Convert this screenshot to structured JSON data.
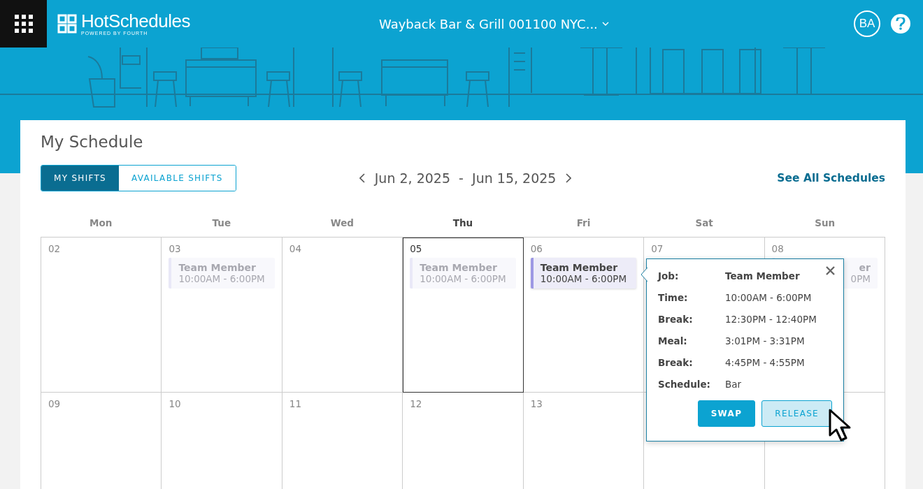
{
  "header": {
    "logo_text": "HotSchedules",
    "logo_tagline": "POWERED BY FOURTH",
    "location": "Wayback Bar & Grill 001100 NYC...",
    "avatar": "BA"
  },
  "page_title": "My Schedule",
  "view_tabs": [
    {
      "label": "MY SHIFTS",
      "selected": true
    },
    {
      "label": "AVAILABLE SHIFTS",
      "selected": false
    }
  ],
  "date_range": {
    "start": "Jun 2, 2025",
    "separator": "-",
    "end": "Jun 15, 2025"
  },
  "see_all_link": "See All Schedules",
  "weekdays": [
    {
      "label": "Mon",
      "today": false
    },
    {
      "label": "Tue",
      "today": false
    },
    {
      "label": "Wed",
      "today": false
    },
    {
      "label": "Thu",
      "today": true
    },
    {
      "label": "Fri",
      "today": false
    },
    {
      "label": "Sat",
      "today": false
    },
    {
      "label": "Sun",
      "today": false
    }
  ],
  "weeks": [
    {
      "days": [
        {
          "date": "02",
          "today": false
        },
        {
          "date": "03",
          "today": false,
          "shifts": [
            {
              "title": "Team Member",
              "time": "10:00AM - 6:00PM",
              "faded": true,
              "selected": false
            }
          ]
        },
        {
          "date": "04",
          "today": false
        },
        {
          "date": "05",
          "today": true,
          "shifts": [
            {
              "title": "Team Member",
              "time": "10:00AM - 6:00PM",
              "faded": true,
              "selected": false
            }
          ]
        },
        {
          "date": "06",
          "today": false,
          "shifts": [
            {
              "title": "Team Member",
              "time": "10:00AM - 6:00PM",
              "faded": false,
              "selected": true
            }
          ]
        },
        {
          "date": "07",
          "today": false
        },
        {
          "date": "08",
          "today": false,
          "shifts": [
            {
              "title": "er",
              "time": "0PM",
              "faded": true,
              "selected": false
            }
          ]
        }
      ]
    },
    {
      "days": [
        {
          "date": "09",
          "today": false
        },
        {
          "date": "10",
          "today": false
        },
        {
          "date": "11",
          "today": false
        },
        {
          "date": "12",
          "today": false
        },
        {
          "date": "13",
          "today": false
        }
      ]
    }
  ],
  "popover": {
    "rows": [
      {
        "label": "Job:",
        "value": "Team Member",
        "bold": true
      },
      {
        "label": "Time:",
        "value": "10:00AM - 6:00PM",
        "bold": false
      },
      {
        "label": "Break:",
        "value": "12:30PM - 12:40PM",
        "bold": false
      },
      {
        "label": "Meal:",
        "value": "3:01PM - 3:31PM",
        "bold": false
      },
      {
        "label": "Break:",
        "value": "4:45PM - 4:55PM",
        "bold": false
      },
      {
        "label": "Schedule:",
        "value": "Bar",
        "bold": false
      }
    ],
    "buttons": [
      {
        "label": "SWAP",
        "kind": "primary"
      },
      {
        "label": "RELEASE",
        "kind": "secondary"
      }
    ]
  }
}
